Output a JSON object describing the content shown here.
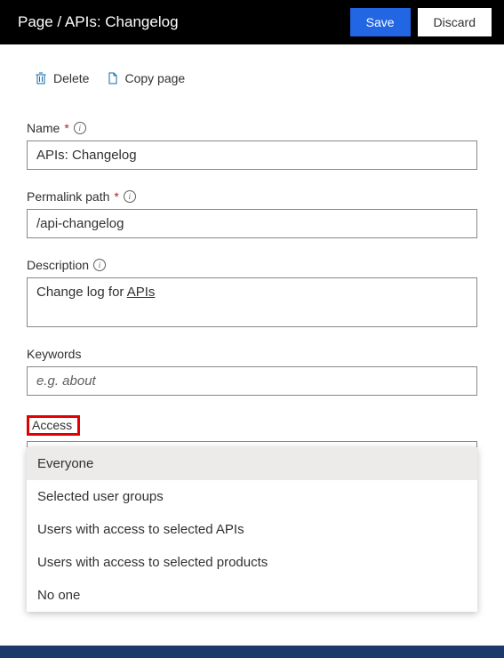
{
  "header": {
    "title": "Page / APIs: Changelog",
    "save": "Save",
    "discard": "Discard"
  },
  "toolbar": {
    "delete": "Delete",
    "copy": "Copy page"
  },
  "fields": {
    "name": {
      "label": "Name",
      "value": "APIs: Changelog"
    },
    "permalink": {
      "label": "Permalink path",
      "value": "/api-changelog"
    },
    "description": {
      "label": "Description",
      "value_prefix": "Change log for ",
      "value_underlined": "APIs"
    },
    "keywords": {
      "label": "Keywords",
      "placeholder": "e.g. about"
    },
    "access": {
      "label": "Access",
      "selected": "Everyone",
      "options": [
        "Everyone",
        "Selected user groups",
        "Users with access to selected APIs",
        "Users with access to selected products",
        "No one"
      ]
    }
  }
}
